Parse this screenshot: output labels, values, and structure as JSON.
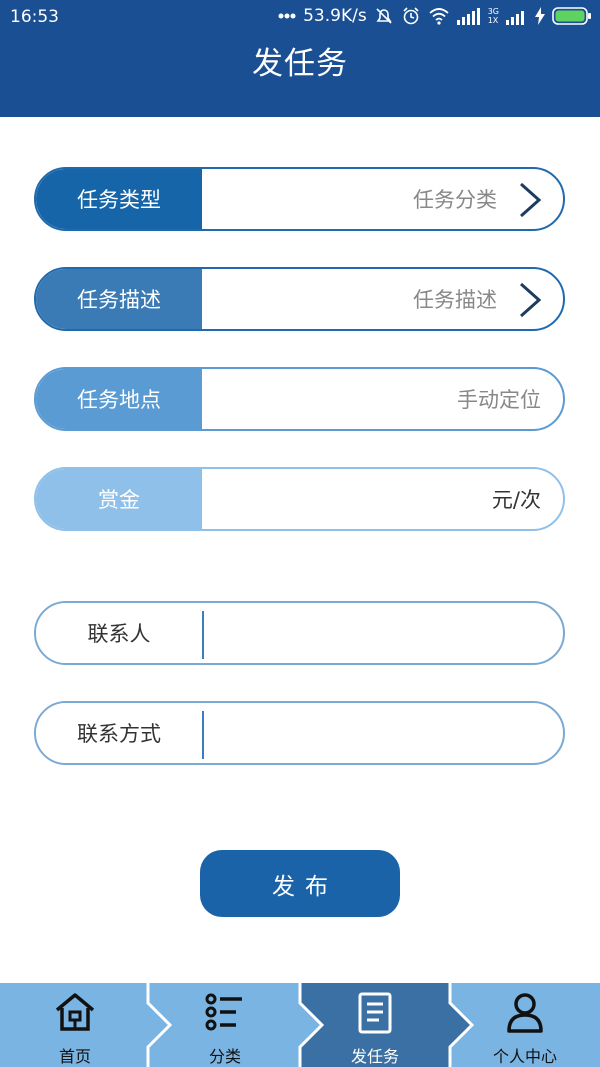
{
  "status_bar": {
    "time": "16:53",
    "speed": "53.9K/s",
    "network": "3G",
    "sim": "1X"
  },
  "header": {
    "title": "发任务"
  },
  "form": {
    "task_type": {
      "label": "任务类型",
      "value": "任务分类"
    },
    "task_desc": {
      "label": "任务描述",
      "value": "任务描述"
    },
    "task_place": {
      "label": "任务地点",
      "value": "手动定位"
    },
    "reward": {
      "label": "赏金",
      "value": "元/次"
    },
    "contact": {
      "label": "联系人",
      "value": ""
    },
    "contact_method": {
      "label": "联系方式",
      "value": ""
    }
  },
  "publish_label": "发布",
  "nav": {
    "home": "首页",
    "category": "分类",
    "post_task": "发任务",
    "profile": "个人中心",
    "active": "post_task"
  },
  "colors": {
    "header_bg": "#1a4f93",
    "label_1": "#1565a8",
    "label_2": "#3a7ab5",
    "label_3": "#5a9bd4",
    "label_4": "#8ec0ea",
    "nav_bg": "#7ab4e3",
    "nav_active_bg": "#3a70a3"
  }
}
